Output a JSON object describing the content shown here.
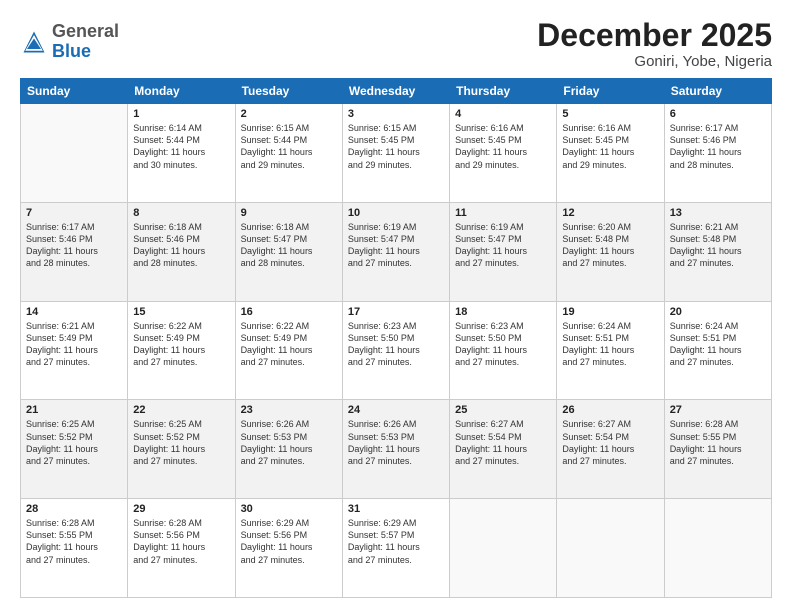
{
  "header": {
    "logo": {
      "line1": "General",
      "line2": "Blue"
    },
    "title": "December 2025",
    "subtitle": "Goniri, Yobe, Nigeria"
  },
  "columns": [
    "Sunday",
    "Monday",
    "Tuesday",
    "Wednesday",
    "Thursday",
    "Friday",
    "Saturday"
  ],
  "weeks": [
    {
      "shaded": false,
      "days": [
        {
          "num": "",
          "text": ""
        },
        {
          "num": "1",
          "text": "Sunrise: 6:14 AM\nSunset: 5:44 PM\nDaylight: 11 hours\nand 30 minutes."
        },
        {
          "num": "2",
          "text": "Sunrise: 6:15 AM\nSunset: 5:44 PM\nDaylight: 11 hours\nand 29 minutes."
        },
        {
          "num": "3",
          "text": "Sunrise: 6:15 AM\nSunset: 5:45 PM\nDaylight: 11 hours\nand 29 minutes."
        },
        {
          "num": "4",
          "text": "Sunrise: 6:16 AM\nSunset: 5:45 PM\nDaylight: 11 hours\nand 29 minutes."
        },
        {
          "num": "5",
          "text": "Sunrise: 6:16 AM\nSunset: 5:45 PM\nDaylight: 11 hours\nand 29 minutes."
        },
        {
          "num": "6",
          "text": "Sunrise: 6:17 AM\nSunset: 5:46 PM\nDaylight: 11 hours\nand 28 minutes."
        }
      ]
    },
    {
      "shaded": true,
      "days": [
        {
          "num": "7",
          "text": "Sunrise: 6:17 AM\nSunset: 5:46 PM\nDaylight: 11 hours\nand 28 minutes."
        },
        {
          "num": "8",
          "text": "Sunrise: 6:18 AM\nSunset: 5:46 PM\nDaylight: 11 hours\nand 28 minutes."
        },
        {
          "num": "9",
          "text": "Sunrise: 6:18 AM\nSunset: 5:47 PM\nDaylight: 11 hours\nand 28 minutes."
        },
        {
          "num": "10",
          "text": "Sunrise: 6:19 AM\nSunset: 5:47 PM\nDaylight: 11 hours\nand 27 minutes."
        },
        {
          "num": "11",
          "text": "Sunrise: 6:19 AM\nSunset: 5:47 PM\nDaylight: 11 hours\nand 27 minutes."
        },
        {
          "num": "12",
          "text": "Sunrise: 6:20 AM\nSunset: 5:48 PM\nDaylight: 11 hours\nand 27 minutes."
        },
        {
          "num": "13",
          "text": "Sunrise: 6:21 AM\nSunset: 5:48 PM\nDaylight: 11 hours\nand 27 minutes."
        }
      ]
    },
    {
      "shaded": false,
      "days": [
        {
          "num": "14",
          "text": "Sunrise: 6:21 AM\nSunset: 5:49 PM\nDaylight: 11 hours\nand 27 minutes."
        },
        {
          "num": "15",
          "text": "Sunrise: 6:22 AM\nSunset: 5:49 PM\nDaylight: 11 hours\nand 27 minutes."
        },
        {
          "num": "16",
          "text": "Sunrise: 6:22 AM\nSunset: 5:49 PM\nDaylight: 11 hours\nand 27 minutes."
        },
        {
          "num": "17",
          "text": "Sunrise: 6:23 AM\nSunset: 5:50 PM\nDaylight: 11 hours\nand 27 minutes."
        },
        {
          "num": "18",
          "text": "Sunrise: 6:23 AM\nSunset: 5:50 PM\nDaylight: 11 hours\nand 27 minutes."
        },
        {
          "num": "19",
          "text": "Sunrise: 6:24 AM\nSunset: 5:51 PM\nDaylight: 11 hours\nand 27 minutes."
        },
        {
          "num": "20",
          "text": "Sunrise: 6:24 AM\nSunset: 5:51 PM\nDaylight: 11 hours\nand 27 minutes."
        }
      ]
    },
    {
      "shaded": true,
      "days": [
        {
          "num": "21",
          "text": "Sunrise: 6:25 AM\nSunset: 5:52 PM\nDaylight: 11 hours\nand 27 minutes."
        },
        {
          "num": "22",
          "text": "Sunrise: 6:25 AM\nSunset: 5:52 PM\nDaylight: 11 hours\nand 27 minutes."
        },
        {
          "num": "23",
          "text": "Sunrise: 6:26 AM\nSunset: 5:53 PM\nDaylight: 11 hours\nand 27 minutes."
        },
        {
          "num": "24",
          "text": "Sunrise: 6:26 AM\nSunset: 5:53 PM\nDaylight: 11 hours\nand 27 minutes."
        },
        {
          "num": "25",
          "text": "Sunrise: 6:27 AM\nSunset: 5:54 PM\nDaylight: 11 hours\nand 27 minutes."
        },
        {
          "num": "26",
          "text": "Sunrise: 6:27 AM\nSunset: 5:54 PM\nDaylight: 11 hours\nand 27 minutes."
        },
        {
          "num": "27",
          "text": "Sunrise: 6:28 AM\nSunset: 5:55 PM\nDaylight: 11 hours\nand 27 minutes."
        }
      ]
    },
    {
      "shaded": false,
      "days": [
        {
          "num": "28",
          "text": "Sunrise: 6:28 AM\nSunset: 5:55 PM\nDaylight: 11 hours\nand 27 minutes."
        },
        {
          "num": "29",
          "text": "Sunrise: 6:28 AM\nSunset: 5:56 PM\nDaylight: 11 hours\nand 27 minutes."
        },
        {
          "num": "30",
          "text": "Sunrise: 6:29 AM\nSunset: 5:56 PM\nDaylight: 11 hours\nand 27 minutes."
        },
        {
          "num": "31",
          "text": "Sunrise: 6:29 AM\nSunset: 5:57 PM\nDaylight: 11 hours\nand 27 minutes."
        },
        {
          "num": "",
          "text": ""
        },
        {
          "num": "",
          "text": ""
        },
        {
          "num": "",
          "text": ""
        }
      ]
    }
  ]
}
